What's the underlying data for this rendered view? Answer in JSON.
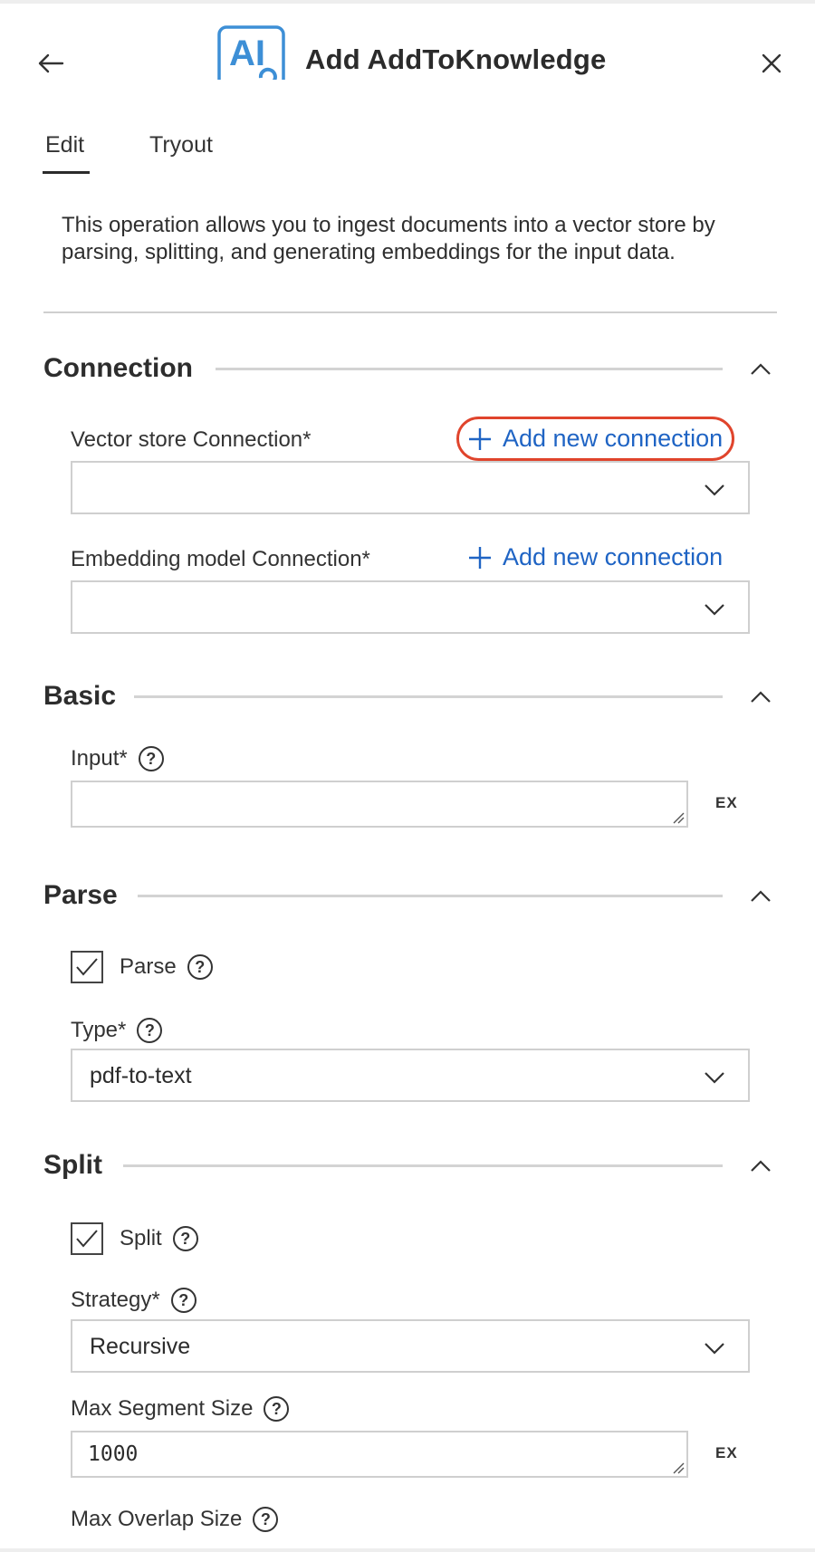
{
  "header": {
    "logo_text": "AI",
    "title": "Add AddToKnowledge"
  },
  "tabs": [
    {
      "label": "Edit",
      "active": true
    },
    {
      "label": "Tryout",
      "active": false
    }
  ],
  "description": "This operation allows you to ingest documents into a vector store by parsing, splitting, and generating embeddings for the input data.",
  "sections": {
    "connection": {
      "title": "Connection",
      "fields": [
        {
          "label": "Vector store Connection*",
          "add_label": "Add new connection",
          "value": ""
        },
        {
          "label": "Embedding model Connection*",
          "add_label": "Add new connection",
          "value": ""
        }
      ]
    },
    "basic": {
      "title": "Basic",
      "input_label": "Input*",
      "input_value": "",
      "ex_label": "EX"
    },
    "parse": {
      "title": "Parse",
      "checkbox_label": "Parse",
      "checked": true,
      "type_label": "Type*",
      "type_value": "pdf-to-text"
    },
    "split": {
      "title": "Split",
      "checkbox_label": "Split",
      "checked": true,
      "strategy_label": "Strategy*",
      "strategy_value": "Recursive",
      "max_segment_label": "Max Segment Size",
      "max_segment_value": "1000",
      "ex_label": "EX",
      "max_overlap_label": "Max Overlap Size"
    }
  },
  "help_glyph": "?",
  "colors": {
    "link": "#1f64c4",
    "highlight": "#e0442c",
    "logo": "#3d8fd6"
  }
}
